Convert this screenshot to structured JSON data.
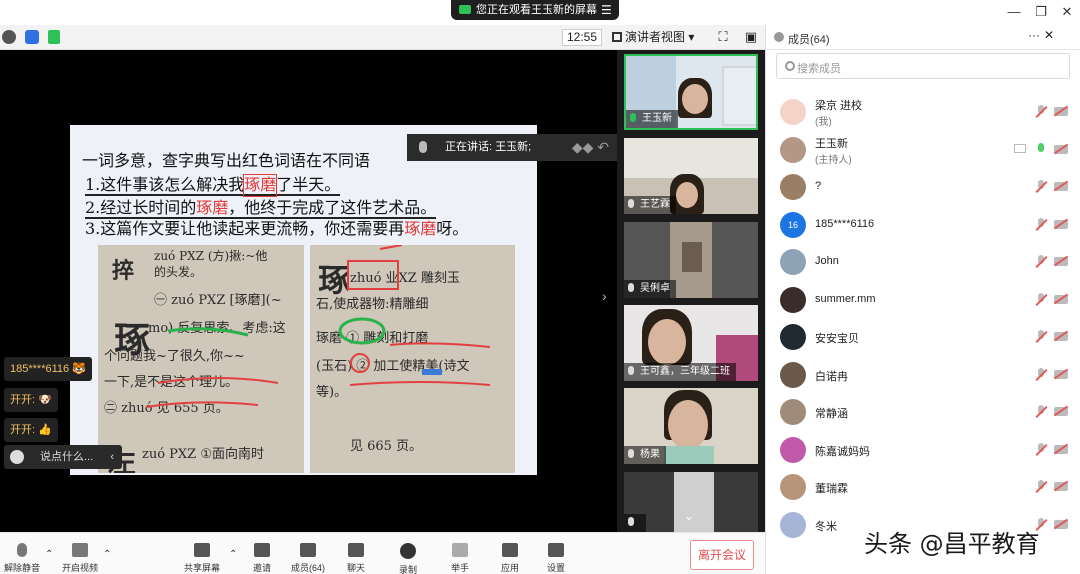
{
  "window": {
    "share_banner": "您正在观看王玉新的屏幕",
    "menu_glyph": "☰",
    "minimize": "—",
    "restore": "❐",
    "close": "✕"
  },
  "toolbar": {
    "time": "12:55",
    "view_mode": "演讲者视图",
    "fullscreen_glyph": "⛶",
    "layout_glyph": "▣"
  },
  "slide": {
    "line1": "一词多意，查字典写出红色词语在不同语",
    "line2_pre": "1.这件事该怎么解决我",
    "line2_red": "琢磨",
    "line2_post": "了半天。",
    "line3_pre": "2.经过长时间的",
    "line3_red": "琢磨",
    "line3_post": "，他终于完成了这件艺术品。",
    "line4_pre": "3.这篇作文要让他读起来更流畅，你还需要再",
    "line4_red": "琢磨",
    "line4_post": "呀。",
    "photo_left": {
      "lines": [
        "zuó PXZ (方)揪:~他",
        "的头发。",
        "㊀ zuó PXZ [琢磨](~",
        "mo) 反复思索、考虑:这",
        "个问题我~了很久,你~~",
        "一下,是不是这个理儿。",
        "㊁ zhuó 见 655 页。",
        "zuó PXZ ①面向南时"
      ],
      "big1": "捽",
      "big2": "琢",
      "big3": "左"
    },
    "photo_right": {
      "lines": [
        "zhuó 业XZ 雕刻玉",
        "石,使成器物:精雕细",
        "琢磨 ① 雕刻和打磨",
        "(玉石) ② 加工使精美(诗文",
        "等)。",
        "见 665 页。"
      ],
      "big1": "琢"
    }
  },
  "speaking": {
    "label": "正在讲话: 王玉新;",
    "controls": "◆◆ ↶"
  },
  "chat": {
    "items": [
      {
        "user": "185****6116",
        "emoji": "🐯"
      },
      {
        "user": "开开:",
        "emoji": "🐶"
      },
      {
        "user": "开开:",
        "emoji": "👍"
      }
    ],
    "input_placeholder": "说点什么...",
    "collapse_glyph": "‹"
  },
  "video_strip": {
    "tiles": [
      {
        "name": "王玉新"
      },
      {
        "name": "王艺霖"
      },
      {
        "name": "吴俐卓"
      },
      {
        "name": "王可鑫，三年级二班"
      },
      {
        "name": "杨果"
      },
      {
        "name": ""
      }
    ],
    "up_glyph": "⌃",
    "down_glyph": "⌄",
    "side_arrow": "›"
  },
  "panel": {
    "title": "成员(64)",
    "more": "···",
    "close": "✕",
    "search_placeholder": "搜索成员",
    "members": [
      {
        "name": "梁京 进校",
        "sub": "(我)",
        "avatar": "",
        "mic": "muted",
        "cam": "off",
        "share": false,
        "color": "#f5d3c6"
      },
      {
        "name": "王玉新",
        "sub": "(主持人)",
        "avatar": "",
        "mic": "on",
        "cam": "off",
        "share": true,
        "color": "#b59785"
      },
      {
        "name": "?",
        "sub": "",
        "avatar": "",
        "mic": "muted",
        "cam": "off",
        "share": false,
        "color": "#9a7e66"
      },
      {
        "name": "185****6116",
        "sub": "",
        "avatar": "16",
        "mic": "muted",
        "cam": "off",
        "share": false,
        "color": "#1d74e3"
      },
      {
        "name": "John",
        "sub": "",
        "avatar": "",
        "mic": "muted",
        "cam": "off",
        "share": false,
        "color": "#8ea3b5"
      },
      {
        "name": "summer.mm",
        "sub": "",
        "avatar": "",
        "mic": "muted",
        "cam": "off",
        "share": false,
        "color": "#3a2c28"
      },
      {
        "name": "安安宝贝",
        "sub": "",
        "avatar": "",
        "mic": "muted",
        "cam": "off",
        "share": false,
        "color": "#1f2a33"
      },
      {
        "name": "白诺冉",
        "sub": "",
        "avatar": "",
        "mic": "muted",
        "cam": "off",
        "share": false,
        "color": "#6b5a4a"
      },
      {
        "name": "常静涵",
        "sub": "",
        "avatar": "",
        "mic": "muted",
        "cam": "off",
        "share": false,
        "color": "#a08a78"
      },
      {
        "name": "陈嘉诚妈妈",
        "sub": "",
        "avatar": "",
        "mic": "muted",
        "cam": "off",
        "share": false,
        "color": "#c05aa8"
      },
      {
        "name": "董瑞霖",
        "sub": "",
        "avatar": "",
        "mic": "muted",
        "cam": "off",
        "share": false,
        "color": "#b89478"
      },
      {
        "name": "冬米",
        "sub": "",
        "avatar": "",
        "mic": "muted",
        "cam": "off",
        "share": false,
        "color": "#a6b4d6"
      }
    ]
  },
  "bottombar": {
    "items": [
      {
        "label": "解除静音",
        "name": "unmute-button",
        "icon": "mic-muted-icon"
      },
      {
        "label": "开启视频",
        "name": "start-video-button",
        "icon": "camera-off-icon"
      },
      {
        "label": "共享屏幕",
        "name": "share-screen-button",
        "icon": "share-screen-icon"
      },
      {
        "label": "邀请",
        "name": "invite-button",
        "icon": "add-user-icon"
      },
      {
        "label": "成员(64)",
        "name": "members-button",
        "icon": "members-icon"
      },
      {
        "label": "聊天",
        "name": "chat-button",
        "icon": "chat-icon"
      },
      {
        "label": "录制",
        "name": "record-button",
        "icon": "record-icon"
      },
      {
        "label": "举手",
        "name": "raise-hand-button",
        "icon": "hand-icon"
      },
      {
        "label": "应用",
        "name": "apps-button",
        "icon": "apps-icon"
      },
      {
        "label": "设置",
        "name": "settings-button",
        "icon": "gear-icon"
      }
    ],
    "leave": "离开会议"
  },
  "watermark": "头条 @昌平教育",
  "colors": {
    "accent_green": "#2ec15a",
    "leave_red": "#e05050",
    "highlight_red": "#e53b3b"
  }
}
